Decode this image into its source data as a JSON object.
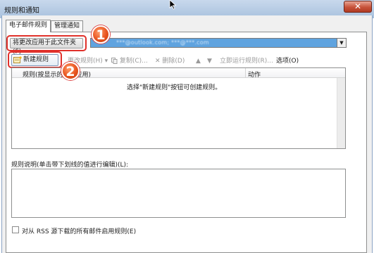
{
  "window": {
    "title": "规则和通知",
    "close_label": "✕"
  },
  "tabs": [
    {
      "label": "电子邮件规则",
      "active": true
    },
    {
      "label": "管理通知",
      "active": false
    }
  ],
  "folder_row": {
    "apply_button_label": "将更改应用于此文件夹(F)",
    "account_value": "***@outlook.com; ***@***.com"
  },
  "toolbar": {
    "new_rule": "新建规则(N)",
    "change_rule": "更改规则(H)",
    "copy": "复制(C)...",
    "delete": "删除(D)",
    "run_now": "立即运行规则(R)...",
    "options": "选项(O)"
  },
  "rules_list": {
    "col_rule": "规则(按显示的顺序应用)",
    "col_action": "动作",
    "empty_message": "选择\"新建规则\"按钮可创建规则。"
  },
  "rule_description_label": "规则说明(单击带下划线的值进行编辑)(L):",
  "rss_checkbox_label": "对从 RSS 源下载的所有邮件启用规则(E)",
  "annotations": {
    "badge_1": "1",
    "badge_2": "2"
  },
  "colors": {
    "annotation_red": "#e0312b",
    "badge_orange": "#e8531f",
    "selection_blue": "#5fa3df"
  }
}
